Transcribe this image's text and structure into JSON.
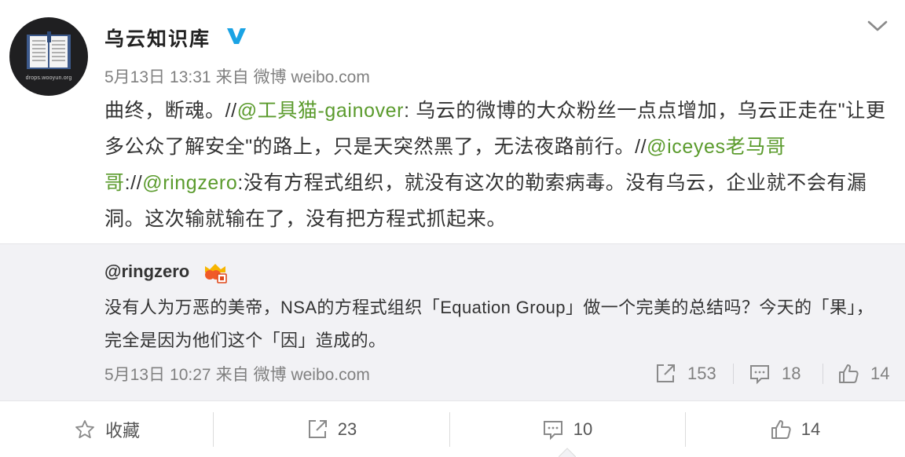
{
  "post": {
    "author": "乌云知识库",
    "avatar_caption": "drops.wooyun.org",
    "meta": {
      "date": "5月13日",
      "time": "13:31",
      "via": "来自",
      "source": "微博 weibo.com"
    },
    "text": {
      "t1": "曲终，断魂。//",
      "m1": "@工具猫-gainover",
      "t2": ": 乌云的微博的大众粉丝一点点增加，乌云正走在\"让更多公众了解安全\"的路上，只是天突然黑了，无法夜路前行。//",
      "m2": "@iceyes老马哥哥",
      "t3": "://",
      "m3": "@ringzero",
      "t4": ":没有方程式组织，就没有这次的勒索病毒。没有乌云，企业就不会有漏洞。这次输就输在了，没有把方程式抓起来。"
    }
  },
  "repost": {
    "user": "@ringzero",
    "text": "没有人为万恶的美帝，NSA的方程式组织「Equation Group」做一个完美的总结吗？今天的「果」，完全是因为他们这个「因」造成的。",
    "meta": {
      "date": "5月13日",
      "time": "10:27",
      "via": "来自",
      "source": "微博 weibo.com"
    },
    "stats": {
      "reposts": "153",
      "comments": "18",
      "likes": "14"
    }
  },
  "actions": {
    "favorite": "收藏",
    "repost": "23",
    "comment": "10",
    "like": "14"
  },
  "colors": {
    "mention": "#5b9b2d",
    "verified": "#1aa3e4",
    "meta": "#808080",
    "repost_bg": "#f2f2f5"
  },
  "icons": [
    "verified-icon",
    "chevron-down-icon",
    "crown-badge-icon",
    "repost-icon",
    "comment-icon",
    "like-icon",
    "star-icon"
  ]
}
